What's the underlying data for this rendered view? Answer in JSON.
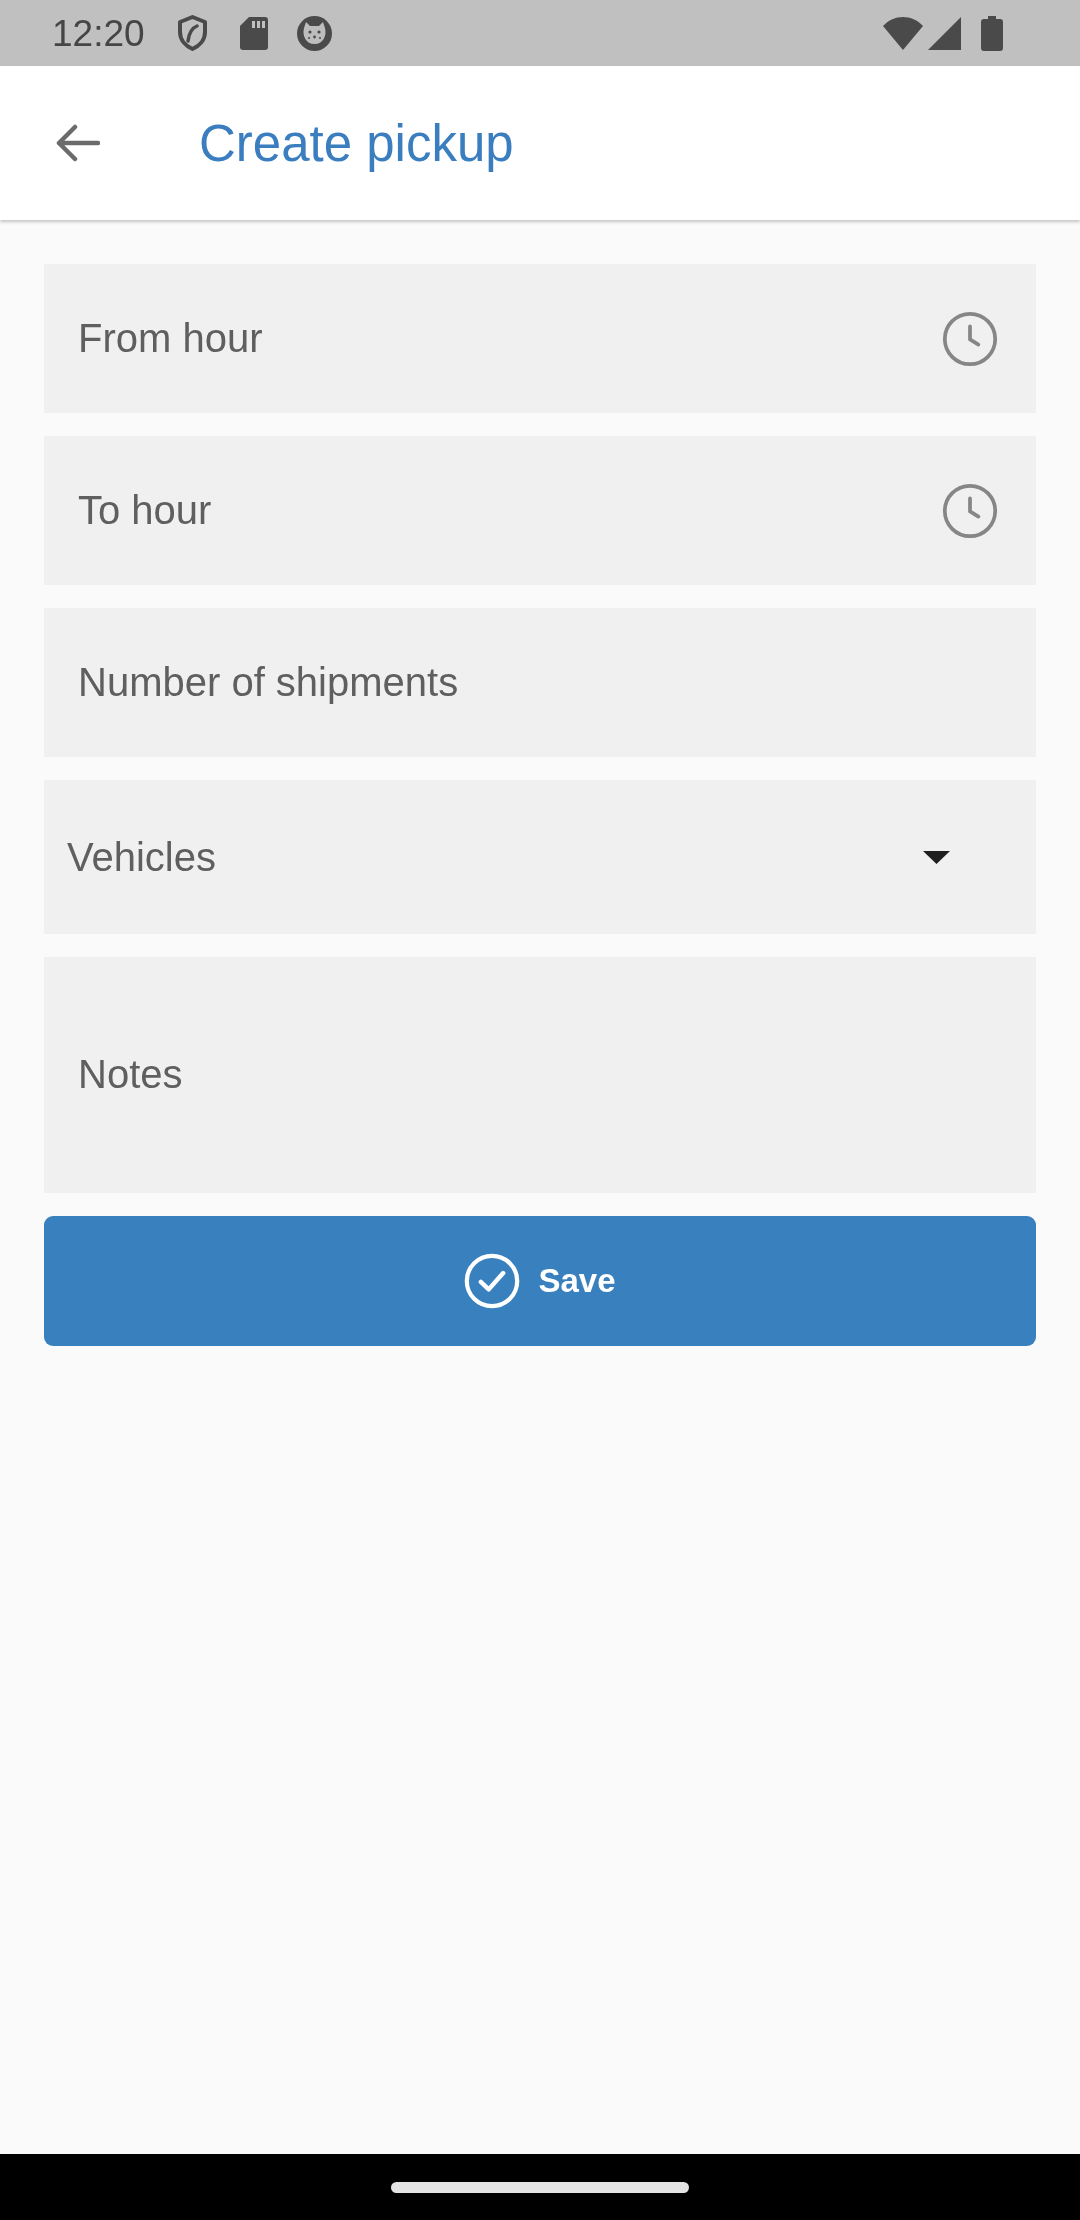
{
  "status_bar": {
    "time": "12:20"
  },
  "app_bar": {
    "title": "Create pickup"
  },
  "form": {
    "fields": [
      {
        "kind": "time",
        "placeholder": "From hour"
      },
      {
        "kind": "time",
        "placeholder": "To hour"
      },
      {
        "kind": "number",
        "placeholder": "Number of shipments"
      },
      {
        "kind": "select",
        "label": "Vehicles"
      },
      {
        "kind": "textarea",
        "placeholder": "Notes"
      }
    ],
    "save_button": {
      "label": "Save"
    }
  }
}
